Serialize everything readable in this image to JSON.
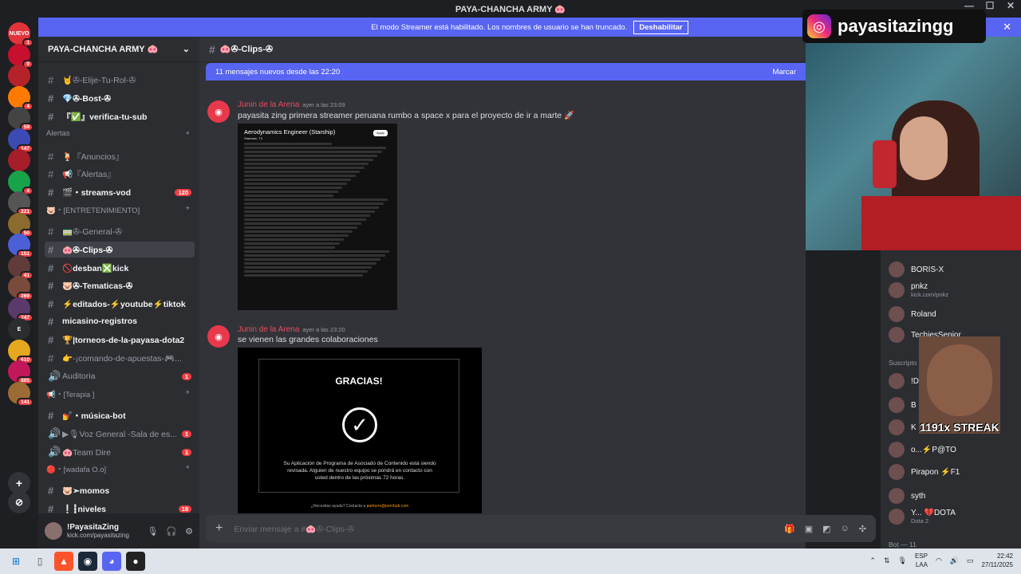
{
  "window": {
    "title": "PAYA-CHANCHA ARMY 🐽"
  },
  "banner": {
    "text": "El modo Streamer está habilitado. Los nombres de usuario se han truncado.",
    "button": "Deshabilitar"
  },
  "servers": [
    {
      "label": "NUEVO",
      "badge": "1"
    },
    {
      "label": "",
      "badge": "9"
    },
    {
      "label": "",
      "badge": ""
    },
    {
      "label": "",
      "badge": "4"
    },
    {
      "label": "",
      "badge": "59"
    },
    {
      "label": "",
      "badge": "147"
    },
    {
      "label": "",
      "badge": ""
    },
    {
      "label": "",
      "badge": "4"
    },
    {
      "label": "",
      "badge": "221"
    },
    {
      "label": "",
      "badge": "50"
    },
    {
      "label": "",
      "badge": "151"
    },
    {
      "label": "",
      "badge": "41"
    },
    {
      "label": "",
      "badge": "269"
    },
    {
      "label": "",
      "badge": "247"
    },
    {
      "label": "E",
      "badge": ""
    },
    {
      "label": "",
      "badge": "610"
    },
    {
      "label": "",
      "badge": "805"
    },
    {
      "label": "",
      "badge": "141"
    }
  ],
  "guild": {
    "name": "PAYA-CHANCHA ARMY 🐽"
  },
  "channels": [
    {
      "name": "🤘✇-Elije-Tu-Rol-✇",
      "unread": ""
    },
    {
      "name": "💎✇-Bost-✇",
      "unread": ""
    },
    {
      "name": "『✅』verifica-tu-sub",
      "unread": ""
    },
    {
      "name": "🍹『Anuncios』",
      "unread": ""
    },
    {
      "name": "📢『Alertas』",
      "unread": ""
    },
    {
      "name": "🎬・streams-vod",
      "unread": "120"
    },
    {
      "name": "🚃✇-General-✇",
      "unread": ""
    },
    {
      "name": "🐽✇-Clips-✇",
      "unread": ""
    },
    {
      "name": "🚫desban❎kick",
      "unread": ""
    },
    {
      "name": "🐷✇-Tematicas-✇",
      "unread": ""
    },
    {
      "name": "⚡editados-⚡youtube⚡tiktok",
      "unread": ""
    },
    {
      "name": "micasino-registros",
      "unread": ""
    },
    {
      "name": "🏆|torneos-de-la-payasa-dota2",
      "unread": ""
    },
    {
      "name": "👉-¡comando-de-apuestas-🎮...",
      "unread": ""
    },
    {
      "name": "Auditoria",
      "unread": "1"
    },
    {
      "name": "💅・música-bot",
      "unread": ""
    },
    {
      "name": "▶︎🎙Voz General -Sala de es...",
      "unread": "1"
    },
    {
      "name": "🐽Team Dire",
      "unread": "1"
    },
    {
      "name": "🐷➣momos",
      "unread": ""
    },
    {
      "name": "❕┇niveles",
      "unread": "18"
    }
  ],
  "categories": [
    "Alertas",
    "🐷・[ENTRETENIMIENTO]",
    "📢・[Terapia ]",
    "🔴・[wadafa O.o]"
  ],
  "user": {
    "name": "!PayasitaZing",
    "status": "kick.com/payasitazing"
  },
  "chat": {
    "channel": "🐽✇-Clips-✇",
    "newbar": "11 mensajes nuevos desde las 22:20",
    "newbar_action": "Marcar",
    "messages": [
      {
        "author": "Junin de la Arena",
        "time": "ayer a las 23:09",
        "text": "payasita zing primera streamer peruana rumbo a space x para el proyecto de ir a marte 🚀"
      },
      {
        "author": "Junin de la Arena",
        "time": "ayer a las 23:20",
        "text": "se vienen las grandes colaboraciones"
      }
    ],
    "job": {
      "title": "Aerodynamics Engineer (Starship)",
      "location": "Starbase, TX",
      "apply": "Apply"
    },
    "gracias": {
      "title": "GRACIAS!",
      "body": "Su Aplicación de Programa de Asociado de Contenido está siendo revisada. Alguien de nuestro equipo se pondrá en contacto con usted dentro de las próximas 72 horas.",
      "help": "¿Necesitas ayuda? Contacta a",
      "email": "partners@pornhub.com"
    },
    "composer_placeholder": "Enviar mensaje a #🐽✇-Clips-✇"
  },
  "overlay": {
    "instagram": "payasitazingg",
    "streak": "1191x STREAK"
  },
  "members": [
    {
      "name": "BORIS-X",
      "sub": ""
    },
    {
      "name": "pnkz",
      "sub": "kick.com/pnkz"
    },
    {
      "name": "Roland",
      "sub": ""
    },
    {
      "name": "TechiesSenior",
      "sub": ""
    }
  ],
  "members_section": "Suscripto",
  "members2": [
    {
      "name": "!D",
      "sub": ""
    },
    {
      "name": "B",
      "sub": ""
    },
    {
      "name": "K",
      "sub": ""
    },
    {
      "name": "o...⚡P@TO",
      "sub": ""
    },
    {
      "name": "Pirapon ⚡F1",
      "sub": ""
    },
    {
      "name": "syth",
      "sub": ""
    },
    {
      "name": "Y... 💔DOTA",
      "sub": "Dota 2"
    }
  ],
  "bot_section": "Bot — 11",
  "taskbar": {
    "lang": "ESP",
    "layout": "LAA",
    "time": "22:42",
    "date": "27/11/2025"
  }
}
